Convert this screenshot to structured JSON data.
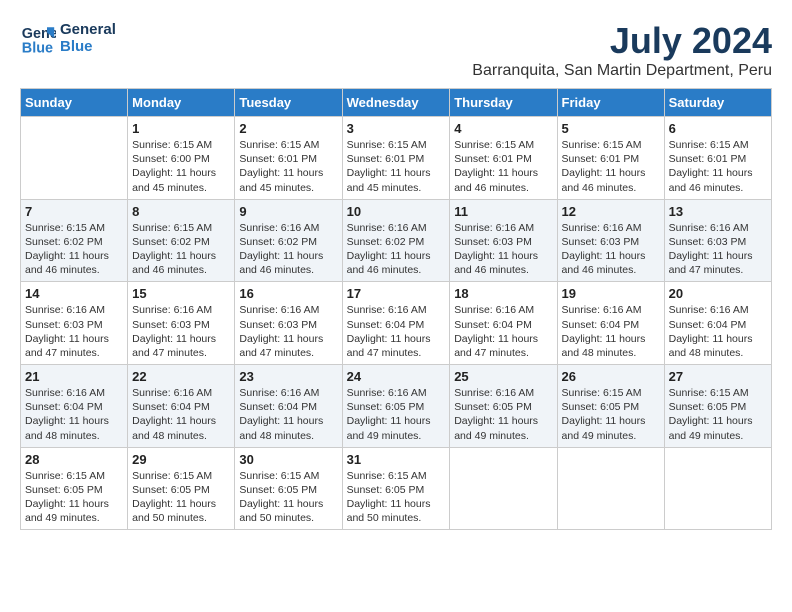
{
  "logo": {
    "line1": "General",
    "line2": "Blue"
  },
  "title": "July 2024",
  "subtitle": "Barranquita, San Martin Department, Peru",
  "days_header": [
    "Sunday",
    "Monday",
    "Tuesday",
    "Wednesday",
    "Thursday",
    "Friday",
    "Saturday"
  ],
  "weeks": [
    [
      {
        "day": "",
        "info": ""
      },
      {
        "day": "1",
        "info": "Sunrise: 6:15 AM\nSunset: 6:00 PM\nDaylight: 11 hours\nand 45 minutes."
      },
      {
        "day": "2",
        "info": "Sunrise: 6:15 AM\nSunset: 6:01 PM\nDaylight: 11 hours\nand 45 minutes."
      },
      {
        "day": "3",
        "info": "Sunrise: 6:15 AM\nSunset: 6:01 PM\nDaylight: 11 hours\nand 45 minutes."
      },
      {
        "day": "4",
        "info": "Sunrise: 6:15 AM\nSunset: 6:01 PM\nDaylight: 11 hours\nand 46 minutes."
      },
      {
        "day": "5",
        "info": "Sunrise: 6:15 AM\nSunset: 6:01 PM\nDaylight: 11 hours\nand 46 minutes."
      },
      {
        "day": "6",
        "info": "Sunrise: 6:15 AM\nSunset: 6:01 PM\nDaylight: 11 hours\nand 46 minutes."
      }
    ],
    [
      {
        "day": "7",
        "info": "Sunrise: 6:15 AM\nSunset: 6:02 PM\nDaylight: 11 hours\nand 46 minutes."
      },
      {
        "day": "8",
        "info": "Sunrise: 6:15 AM\nSunset: 6:02 PM\nDaylight: 11 hours\nand 46 minutes."
      },
      {
        "day": "9",
        "info": "Sunrise: 6:16 AM\nSunset: 6:02 PM\nDaylight: 11 hours\nand 46 minutes."
      },
      {
        "day": "10",
        "info": "Sunrise: 6:16 AM\nSunset: 6:02 PM\nDaylight: 11 hours\nand 46 minutes."
      },
      {
        "day": "11",
        "info": "Sunrise: 6:16 AM\nSunset: 6:03 PM\nDaylight: 11 hours\nand 46 minutes."
      },
      {
        "day": "12",
        "info": "Sunrise: 6:16 AM\nSunset: 6:03 PM\nDaylight: 11 hours\nand 46 minutes."
      },
      {
        "day": "13",
        "info": "Sunrise: 6:16 AM\nSunset: 6:03 PM\nDaylight: 11 hours\nand 47 minutes."
      }
    ],
    [
      {
        "day": "14",
        "info": "Sunrise: 6:16 AM\nSunset: 6:03 PM\nDaylight: 11 hours\nand 47 minutes."
      },
      {
        "day": "15",
        "info": "Sunrise: 6:16 AM\nSunset: 6:03 PM\nDaylight: 11 hours\nand 47 minutes."
      },
      {
        "day": "16",
        "info": "Sunrise: 6:16 AM\nSunset: 6:03 PM\nDaylight: 11 hours\nand 47 minutes."
      },
      {
        "day": "17",
        "info": "Sunrise: 6:16 AM\nSunset: 6:04 PM\nDaylight: 11 hours\nand 47 minutes."
      },
      {
        "day": "18",
        "info": "Sunrise: 6:16 AM\nSunset: 6:04 PM\nDaylight: 11 hours\nand 47 minutes."
      },
      {
        "day": "19",
        "info": "Sunrise: 6:16 AM\nSunset: 6:04 PM\nDaylight: 11 hours\nand 48 minutes."
      },
      {
        "day": "20",
        "info": "Sunrise: 6:16 AM\nSunset: 6:04 PM\nDaylight: 11 hours\nand 48 minutes."
      }
    ],
    [
      {
        "day": "21",
        "info": "Sunrise: 6:16 AM\nSunset: 6:04 PM\nDaylight: 11 hours\nand 48 minutes."
      },
      {
        "day": "22",
        "info": "Sunrise: 6:16 AM\nSunset: 6:04 PM\nDaylight: 11 hours\nand 48 minutes."
      },
      {
        "day": "23",
        "info": "Sunrise: 6:16 AM\nSunset: 6:04 PM\nDaylight: 11 hours\nand 48 minutes."
      },
      {
        "day": "24",
        "info": "Sunrise: 6:16 AM\nSunset: 6:05 PM\nDaylight: 11 hours\nand 49 minutes."
      },
      {
        "day": "25",
        "info": "Sunrise: 6:16 AM\nSunset: 6:05 PM\nDaylight: 11 hours\nand 49 minutes."
      },
      {
        "day": "26",
        "info": "Sunrise: 6:15 AM\nSunset: 6:05 PM\nDaylight: 11 hours\nand 49 minutes."
      },
      {
        "day": "27",
        "info": "Sunrise: 6:15 AM\nSunset: 6:05 PM\nDaylight: 11 hours\nand 49 minutes."
      }
    ],
    [
      {
        "day": "28",
        "info": "Sunrise: 6:15 AM\nSunset: 6:05 PM\nDaylight: 11 hours\nand 49 minutes."
      },
      {
        "day": "29",
        "info": "Sunrise: 6:15 AM\nSunset: 6:05 PM\nDaylight: 11 hours\nand 50 minutes."
      },
      {
        "day": "30",
        "info": "Sunrise: 6:15 AM\nSunset: 6:05 PM\nDaylight: 11 hours\nand 50 minutes."
      },
      {
        "day": "31",
        "info": "Sunrise: 6:15 AM\nSunset: 6:05 PM\nDaylight: 11 hours\nand 50 minutes."
      },
      {
        "day": "",
        "info": ""
      },
      {
        "day": "",
        "info": ""
      },
      {
        "day": "",
        "info": ""
      }
    ]
  ]
}
